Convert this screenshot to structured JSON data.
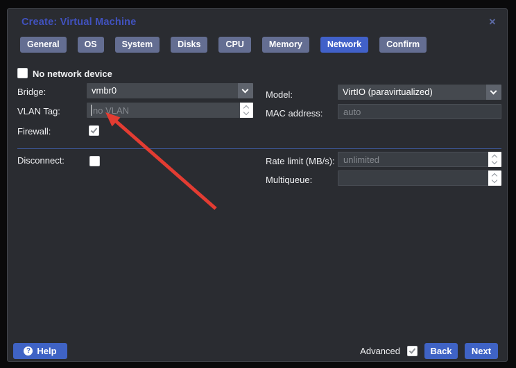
{
  "dialog": {
    "title": "Create: Virtual Machine",
    "close_icon": "✕"
  },
  "tabs": [
    {
      "label": "General",
      "active": false
    },
    {
      "label": "OS",
      "active": false
    },
    {
      "label": "System",
      "active": false
    },
    {
      "label": "Disks",
      "active": false
    },
    {
      "label": "CPU",
      "active": false
    },
    {
      "label": "Memory",
      "active": false
    },
    {
      "label": "Network",
      "active": true
    },
    {
      "label": "Confirm",
      "active": false
    }
  ],
  "form": {
    "no_network_device": {
      "label": "No network device",
      "checked": false
    },
    "bridge": {
      "label": "Bridge:",
      "value": "vmbr0"
    },
    "vlan_tag": {
      "label": "VLAN Tag:",
      "placeholder": "no VLAN",
      "value": ""
    },
    "firewall": {
      "label": "Firewall:",
      "checked": true
    },
    "model": {
      "label": "Model:",
      "value": "VirtIO (paravirtualized)"
    },
    "mac_address": {
      "label": "MAC address:",
      "placeholder": "auto",
      "value": ""
    },
    "disconnect": {
      "label": "Disconnect:",
      "checked": false
    },
    "rate_limit": {
      "label": "Rate limit (MB/s):",
      "placeholder": "unlimited",
      "value": ""
    },
    "multiqueue": {
      "label": "Multiqueue:",
      "placeholder": "",
      "value": ""
    }
  },
  "footer": {
    "help_label": "Help",
    "help_icon": "?",
    "advanced_label": "Advanced",
    "advanced_checked": true,
    "back_label": "Back",
    "next_label": "Next"
  },
  "annotation": {
    "type": "red-arrow",
    "points_at": "vlan-tag-field",
    "color": "#e23c32"
  },
  "colors": {
    "accent_blue": "#3f63c5",
    "tab_inactive": "#646e92",
    "title_blue": "#4152bf",
    "dialog_bg": "#2a2c31",
    "field_bg": "#45494f",
    "divider_blue": "#3c5694",
    "arrow_red": "#e23c32"
  }
}
